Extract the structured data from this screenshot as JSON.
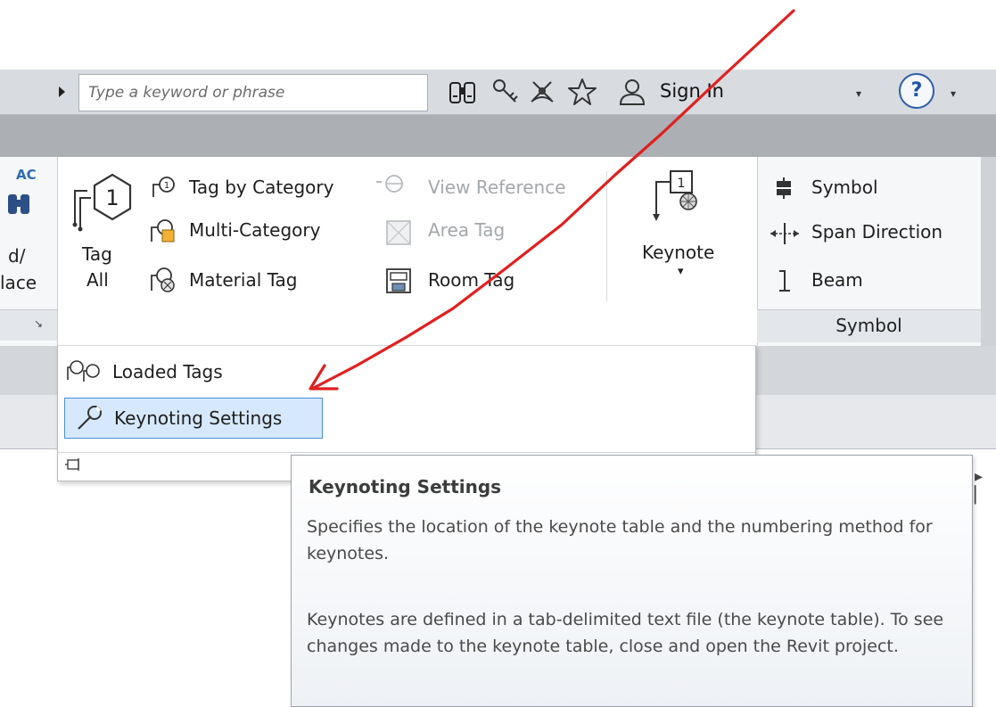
{
  "header": {
    "search": {
      "placeholder": "Type a keyword or phrase",
      "value": ""
    },
    "icons": [
      "binoculars-icon",
      "key-icon",
      "satellite-icon",
      "star-icon",
      "user-icon"
    ],
    "sign_in_label": "Sign In",
    "user_dropdown_label": "▾",
    "help_label": "?",
    "help_dropdown_label": "▾"
  },
  "ribbon": {
    "left_clip": {
      "top_text": "AC",
      "line1": "d/",
      "line2": "lace",
      "corner": "↘"
    },
    "tag_all": {
      "line1": "Tag",
      "line2": "All"
    },
    "tag_col1": [
      {
        "label": "Tag by Category",
        "icon": "tag-by-category-icon"
      },
      {
        "label": "Multi-Category",
        "icon": "multi-category-tag-icon"
      },
      {
        "label": "Material Tag",
        "icon": "material-tag-icon"
      }
    ],
    "tag_col2": [
      {
        "label": "View Reference",
        "icon": "view-reference-icon",
        "disabled": true
      },
      {
        "label": "Area Tag",
        "icon": "area-tag-icon",
        "disabled": true
      },
      {
        "label": "Room Tag",
        "icon": "room-tag-icon",
        "disabled": false
      }
    ],
    "keynote": {
      "label": "Keynote",
      "dropdown": "▾"
    },
    "symbol_panel": {
      "items": [
        {
          "label": "Symbol",
          "icon": "symbol-icon"
        },
        {
          "label": "Span Direction",
          "icon": "span-direction-icon"
        },
        {
          "label": "Beam",
          "icon": "beam-icon"
        }
      ],
      "title": "Symbol"
    }
  },
  "dropdown": {
    "items": [
      {
        "label": "Loaded Tags",
        "icon": "loaded-tags-icon"
      },
      {
        "label": "Keynoting Settings",
        "icon": "wrench-icon",
        "highlighted": true
      }
    ],
    "pin_icon": "pin-icon"
  },
  "tooltip": {
    "title": "Keynoting Settings",
    "paragraph1": "Specifies the location of the keynote table and the numbering method for keynotes.",
    "paragraph2": "Keynotes are defined in a tab-delimited text file (the keynote table). To see changes made to the keynote table, close and open the Revit project."
  },
  "colors": {
    "annotation_arrow": "#e02020",
    "highlight_fill": "#d6e8fb",
    "highlight_border": "#4a8fd9",
    "accent_blue": "#2e5ea8"
  }
}
